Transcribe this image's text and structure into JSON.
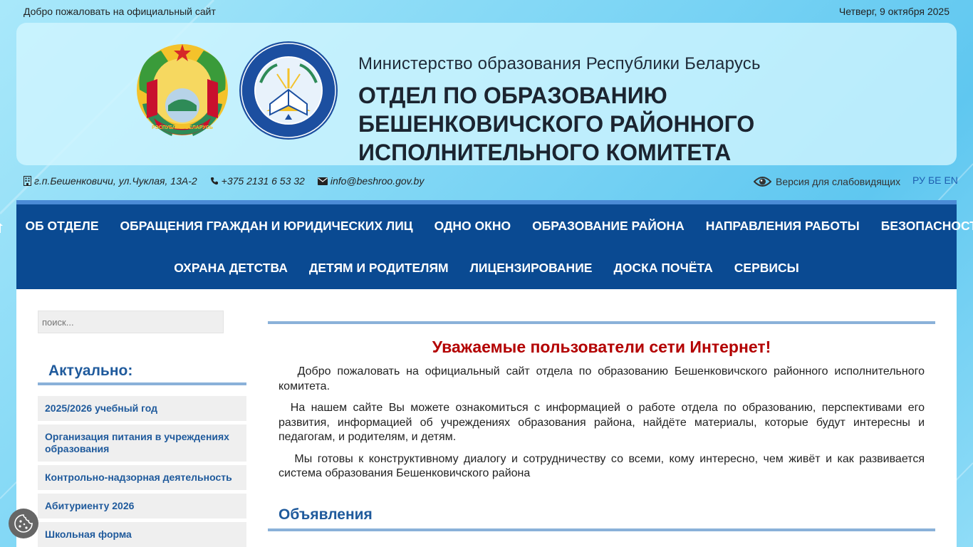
{
  "topbar": {
    "welcome": "Добро пожаловать на официальный сайт",
    "date": "Четверг, 9 октября 2025"
  },
  "header": {
    "ministry": "Министерство образования Республики Беларусь",
    "title": "ОТДЕЛ ПО ОБРАЗОВАНИЮ БЕШЕНКОВИЧСКОГО РАЙОННОГО ИСПОЛНИТЕЛЬНОГО КОМИТЕТА",
    "emblem_text": "РЭСПУБЛІКА БЕЛАРУСЬ",
    "logo_ring_text": "ОТДЕЛ ПО ОБРАЗОВАНИЮ БЕШЕНКОВИЧСКОГО РАЙОННОГО ИСПОЛНИТЕЛЬНОГО КОМИТЕТА"
  },
  "contacts": {
    "address": "г.п.Бешенковичи, ул.Чуклая, 13А-2",
    "phone": "+375 2131 6 53 32",
    "email": "info@beshroo.gov.by",
    "address_icon": "building-icon",
    "phone_icon": "phone-icon",
    "email_icon": "envelope-icon"
  },
  "accessibility": {
    "label": "Версия для слабовидящих",
    "icon": "eye-icon"
  },
  "languages": [
    "РУ",
    "БЕ",
    "EN"
  ],
  "nav": {
    "home_icon": "home-icon",
    "row1": [
      "ОБ ОТДЕЛЕ",
      "ОБРАЩЕНИЯ ГРАЖДАН И ЮРИДИЧЕСКИХ ЛИЦ",
      "ОДНО ОКНО",
      "ОБРАЗОВАНИЕ РАЙОНА",
      "НАПРАВЛЕНИЯ РАБОТЫ",
      "БЕЗОПАСНОСТЬ"
    ],
    "row2": [
      "ОХРАНА ДЕТСТВА",
      "ДЕТЯМ И РОДИТЕЛЯМ",
      "ЛИЦЕНЗИРОВАНИЕ",
      "ДОСКА ПОЧЁТА",
      "СЕРВИСЫ"
    ]
  },
  "sidebar": {
    "search_placeholder": "поиск...",
    "title": "Актуально:",
    "items": [
      "2025/2026 учебный год",
      "Организация питания в учреждениях образования",
      "Контрольно-надзорная деятельность",
      "Абитуриенту 2026",
      "Школьная форма"
    ]
  },
  "main": {
    "heading": "Уважаемые пользователи сети Интернет!",
    "paragraphs": [
      "Добро пожаловать на официальный сайт отдела по образованию Бешенковичского районного исполнительного комитета.",
      "На нашем сайте Вы можете ознакомиться с информацией о работе отдела по образованию, перспективами его развития, информацией об учреждениях образования района, найдёте материалы, которые будут интересны и педагогам, и родителям, и детям.",
      "Мы готовы к конструктивному диалогу и сотрудничеству со всеми, кому интересно, чем живёт и как развивается система образования Бешенковичского района"
    ],
    "announcements_title": "Объявления"
  },
  "cookie": {
    "icon": "cookie-icon"
  },
  "colors": {
    "nav_bg": "#0a4a92",
    "accent_blue": "#1f5a9c",
    "heading_red": "#b30000",
    "divider": "#8ab1d9",
    "link_blue": "#1f5fb0"
  }
}
